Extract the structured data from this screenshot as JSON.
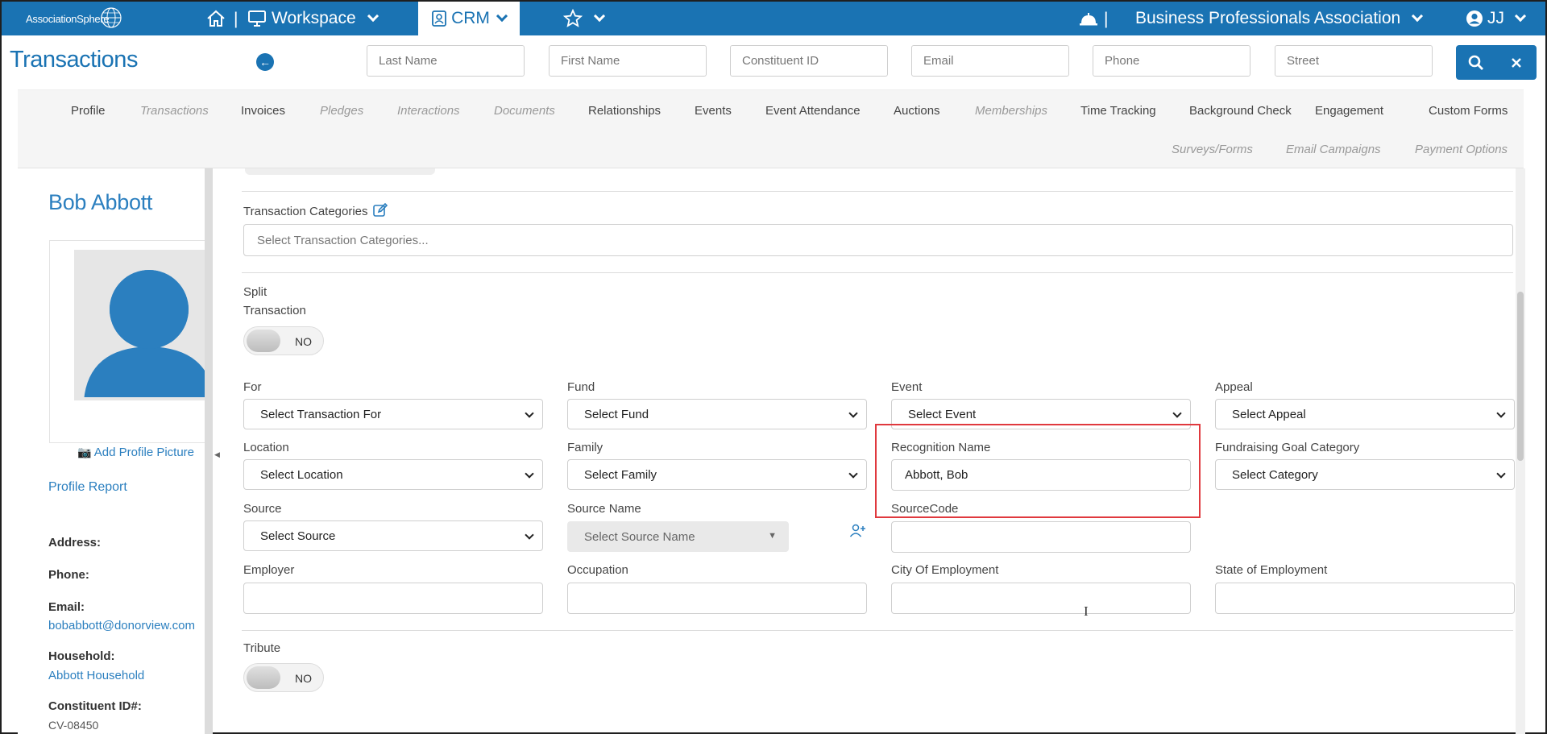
{
  "topbar": {
    "logo_text": "AssociationSphere",
    "workspace_label": "Workspace",
    "crm_label": "CRM",
    "organization": "Business Professionals Association",
    "user_initials": "JJ"
  },
  "header": {
    "title": "Transactions",
    "search_fields": [
      {
        "placeholder": "Last Name"
      },
      {
        "placeholder": "First Name"
      },
      {
        "placeholder": "Constituent ID"
      },
      {
        "placeholder": "Email"
      },
      {
        "placeholder": "Phone"
      },
      {
        "placeholder": "Street"
      }
    ]
  },
  "tabs": [
    {
      "label": "Profile",
      "disabled": false
    },
    {
      "label": "Transactions",
      "disabled": true
    },
    {
      "label": "Invoices",
      "disabled": false
    },
    {
      "label": "Pledges",
      "disabled": true
    },
    {
      "label": "Interactions",
      "disabled": true
    },
    {
      "label": "Documents",
      "disabled": true
    },
    {
      "label": "Relationships",
      "disabled": false
    },
    {
      "label": "Events",
      "disabled": false
    },
    {
      "label": "Event Attendance",
      "disabled": false
    },
    {
      "label": "Auctions",
      "disabled": false
    },
    {
      "label": "Memberships",
      "disabled": true
    },
    {
      "label": "Time Tracking",
      "disabled": false
    },
    {
      "label": "Background Check",
      "disabled": false
    },
    {
      "label": "Engagement",
      "disabled": false
    },
    {
      "label": "Custom Forms",
      "disabled": false
    },
    {
      "label": "Surveys/Forms",
      "disabled": true
    },
    {
      "label": "Email Campaigns",
      "disabled": true
    },
    {
      "label": "Payment Options",
      "disabled": true
    }
  ],
  "sidebar": {
    "name": "Bob Abbott",
    "add_picture": "Add Profile Picture",
    "profile_report": "Profile Report",
    "address_label": "Address:",
    "phone_label": "Phone:",
    "email_label": "Email:",
    "email": "bobabbott@donorview.com",
    "household_label": "Household:",
    "household": "Abbott Household",
    "constituent_id_label": "Constituent ID#:",
    "constituent_id": "CV-08450"
  },
  "form": {
    "categories_label": "Transaction Categories",
    "categories_placeholder": "Select Transaction Categories...",
    "split_label_1": "Split",
    "split_label_2": "Transaction",
    "split_value": "NO",
    "for_label": "For",
    "for_value": "Select Transaction For",
    "fund_label": "Fund",
    "fund_value": "Select Fund",
    "event_label": "Event",
    "event_value": "Select Event",
    "appeal_label": "Appeal",
    "appeal_value": "Select Appeal",
    "location_label": "Location",
    "location_value": "Select Location",
    "family_label": "Family",
    "family_value": "Select Family",
    "recognition_label": "Recognition Name",
    "recognition_value": "Abbott, Bob",
    "fundraising_label": "Fundraising Goal Category",
    "fundraising_value": "Select Category",
    "source_label": "Source",
    "source_value": "Select Source",
    "source_name_label": "Source Name",
    "source_name_value": "Select Source Name",
    "sourcecode_label": "SourceCode",
    "employer_label": "Employer",
    "occupation_label": "Occupation",
    "city_label": "City Of Employment",
    "state_label": "State of Employment",
    "tribute_label": "Tribute",
    "tribute_value": "NO"
  },
  "colors": {
    "brand": "#1a73b3",
    "link": "#2b7fbf",
    "highlight": "#e0393e"
  }
}
